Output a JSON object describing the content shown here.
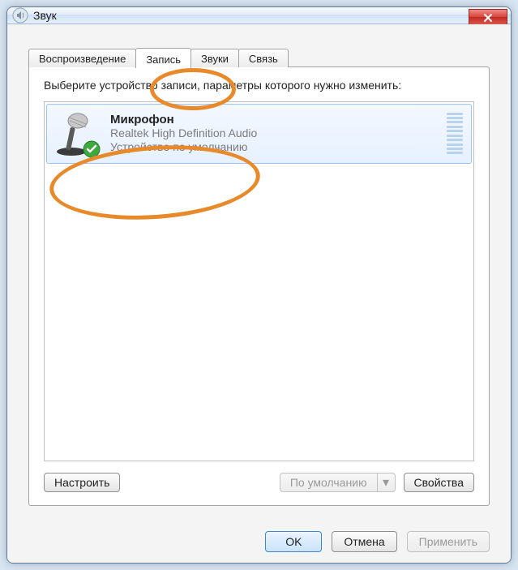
{
  "window": {
    "title": "Звук"
  },
  "tabs": [
    {
      "label": "Воспроизведение",
      "active": false
    },
    {
      "label": "Запись",
      "active": true
    },
    {
      "label": "Звуки",
      "active": false
    },
    {
      "label": "Связь",
      "active": false
    }
  ],
  "panel": {
    "instruction": "Выберите устройство записи, параметры которого нужно изменить:",
    "device": {
      "name": "Микрофон",
      "driver": "Realtek High Definition Audio",
      "status": "Устройство по умолчанию",
      "default": true
    },
    "buttons": {
      "configure": "Настроить",
      "set_default": "По умолчанию",
      "properties": "Свойства"
    }
  },
  "dialog_buttons": {
    "ok": "OK",
    "cancel": "Отмена",
    "apply": "Применить"
  }
}
